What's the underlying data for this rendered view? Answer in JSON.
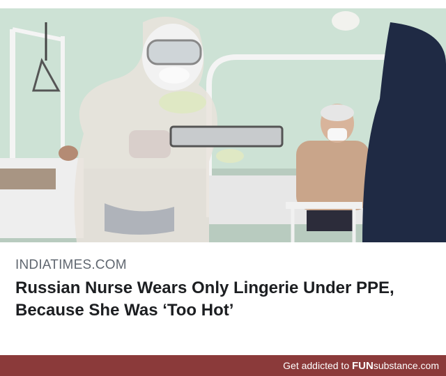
{
  "article": {
    "source": "INDIATIMES.COM",
    "headline_line1": "Russian Nurse Wears Only Lingerie Under PPE,",
    "headline_line2": "Because She Was ‘Too Hot’"
  },
  "footer": {
    "prefix": "Get addicted to ",
    "brand_bold": "FUN",
    "brand_rest": "substance.com"
  },
  "colors": {
    "footer_bg": "#8b3a3a",
    "wall": "#cfe3d6",
    "headline": "#1c1e21",
    "source": "#606770"
  }
}
